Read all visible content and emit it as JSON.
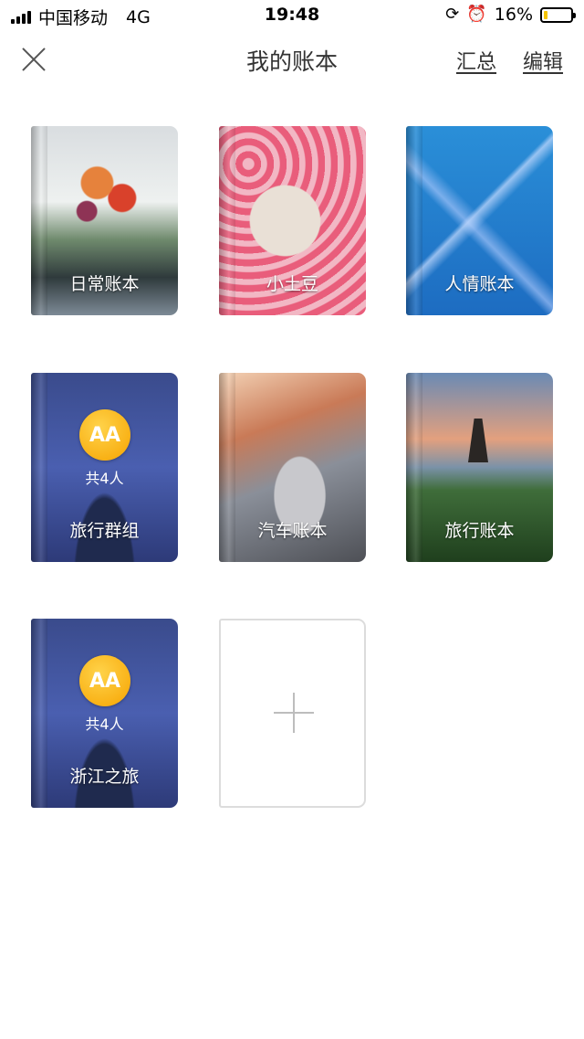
{
  "status_bar": {
    "carrier": "中国移动",
    "network": "4G",
    "time": "19:48",
    "battery_percent": "16%",
    "battery_level": 0.16
  },
  "nav": {
    "title": "我的账本",
    "summary_label": "汇总",
    "edit_label": "编辑"
  },
  "books": [
    {
      "label": "日常账本"
    },
    {
      "label": "小土豆"
    },
    {
      "label": "人情账本"
    },
    {
      "label": "旅行群组",
      "badge": "AA",
      "members": "共4人"
    },
    {
      "label": "汽车账本"
    },
    {
      "label": "旅行账本"
    },
    {
      "label": "浙江之旅",
      "badge": "AA",
      "members": "共4人"
    }
  ],
  "colors": {
    "battery_fill": "#f5c400",
    "badge": "#f6a300"
  }
}
